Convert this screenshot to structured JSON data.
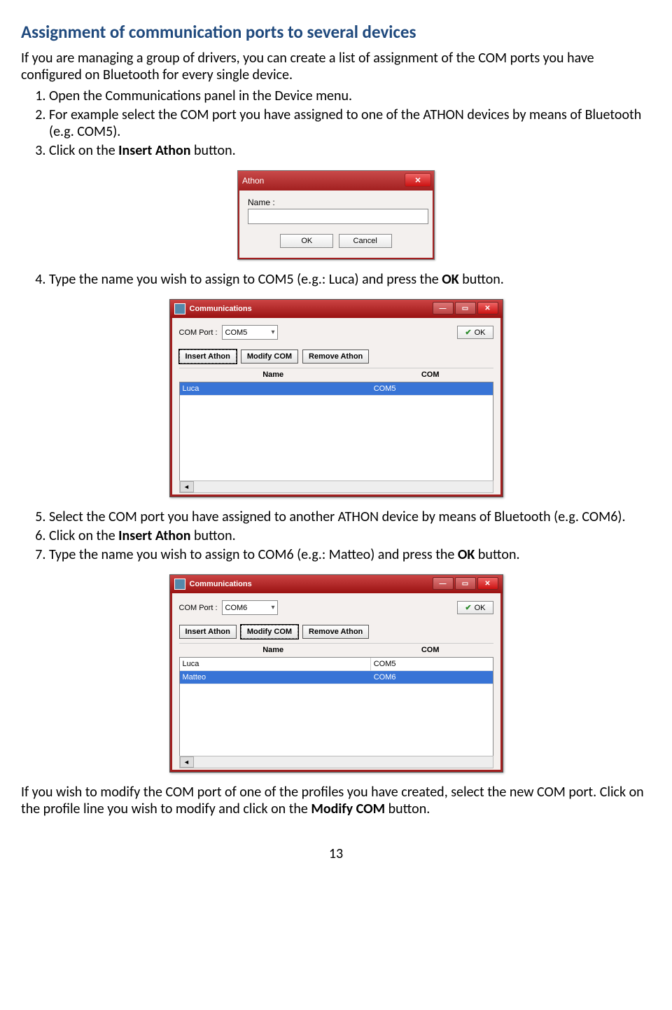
{
  "heading": "Assignment of communication ports to several devices",
  "intro": "If you are managing a group of drivers, you can create a list of assignment of the COM ports you have configured on Bluetooth for every single device.",
  "steps_A": [
    "Open the Communications panel in the Device menu.",
    "For example select the COM port you have assigned to one of the ATHON devices by means of Bluetooth (e.g. COM5).",
    "Click on the "
  ],
  "steps_A3_bold": "Insert Athon",
  "steps_A3_tail": " button.",
  "step4_pre": "Type the name you wish to assign to COM5 (e.g.: Luca) and press the ",
  "step4_bold": "OK",
  "step4_tail": " button.",
  "steps_B": [
    "Select the COM port you have assigned to another ATHON device by means of Bluetooth (e.g. COM6).",
    "Click on the ",
    "Type the name you wish to assign to COM6 (e.g.: Matteo) and press the "
  ],
  "steps_B6_bold": "Insert Athon",
  "steps_B6_tail": " button.",
  "steps_B7_bold": "OK",
  "steps_B7_tail": " button.",
  "outro_a": "If you wish to modify the COM port of one of the profiles you have created, select the new COM port. Click on the profile line you wish to modify and click on the ",
  "outro_bold": "Modify COM",
  "outro_b": " button.",
  "page_number": "13",
  "athon_dialog": {
    "title": "Athon",
    "name_label": "Name :",
    "name_value": "",
    "ok": "OK",
    "cancel": "Cancel"
  },
  "comm_common": {
    "title": "Communications",
    "com_port_label": "COM Port :",
    "ok": "OK",
    "btn_insert": "Insert Athon",
    "btn_modify": "Modify COM",
    "btn_remove": "Remove Athon",
    "col_name": "Name",
    "col_com": "COM"
  },
  "comm1": {
    "combo": "COM5",
    "rows": [
      {
        "name": "Luca",
        "com": "COM5",
        "selected": true
      }
    ]
  },
  "comm2": {
    "combo": "COM6",
    "rows": [
      {
        "name": "Luca",
        "com": "COM5",
        "selected": false
      },
      {
        "name": "Matteo",
        "com": "COM6",
        "selected": true
      }
    ]
  }
}
